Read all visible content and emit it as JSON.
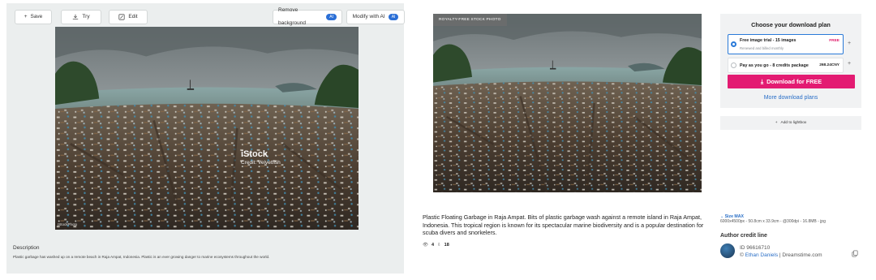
{
  "left_panel": {
    "toolbar": {
      "save_label": "Save",
      "try_label": "Try",
      "edit_label": "Edit",
      "remove_bg_label": "Remove background",
      "modify_ai_label": "Modify with AI",
      "ai_badge": "AI"
    },
    "watermark_brand": "iStock",
    "watermark_credit": "Credit: Velvetfish",
    "watermark_small": "IStockPhoto",
    "description_title": "Description",
    "description_text": "Plastic garbage has washed up on a remote beach in Raja Ampat, Indonesia. Plastic is an ever growing danger to marine ecosystems throughout the world."
  },
  "right_panel": {
    "photo_badge": "ROYALTY-FREE STOCK PHOTO",
    "caption": "Plastic Floating Garbage in Raja Ampat. Bits of plastic garbage wash against a remote island in Raja Ampat, Indonesia. This tropical region is known for its spectacular marine biodiversity and is a popular destination for scuba divers and snorkelers.",
    "views": "4",
    "downloads": "18",
    "download_plan": {
      "title": "Choose your download plan",
      "option1_title": "Free image trial - 15 images",
      "option1_sub": "Renewed and billed monthly",
      "option1_price": "FREE",
      "option2_title": "Pay as you go - 8 credits package",
      "option2_price": "268.24CNY",
      "download_button": "Download for FREE",
      "more_plans": "More download plans"
    },
    "lightbox_label": "Add to lightbox",
    "size": {
      "label": "Size MAX",
      "details": "6000x4500px - 50.8cm x 33.9cm - @300dpi - 16.8MB - jpg"
    },
    "author_credit_heading": "Author credit line",
    "author_id": "ID 96616710",
    "author_name": "Ethan Daniels",
    "author_source": "| Dreamstime.com",
    "colors": {
      "accent_pink": "#e31b72",
      "link_blue": "#2a6fc7",
      "ai_blue": "#2b6fd6"
    }
  }
}
